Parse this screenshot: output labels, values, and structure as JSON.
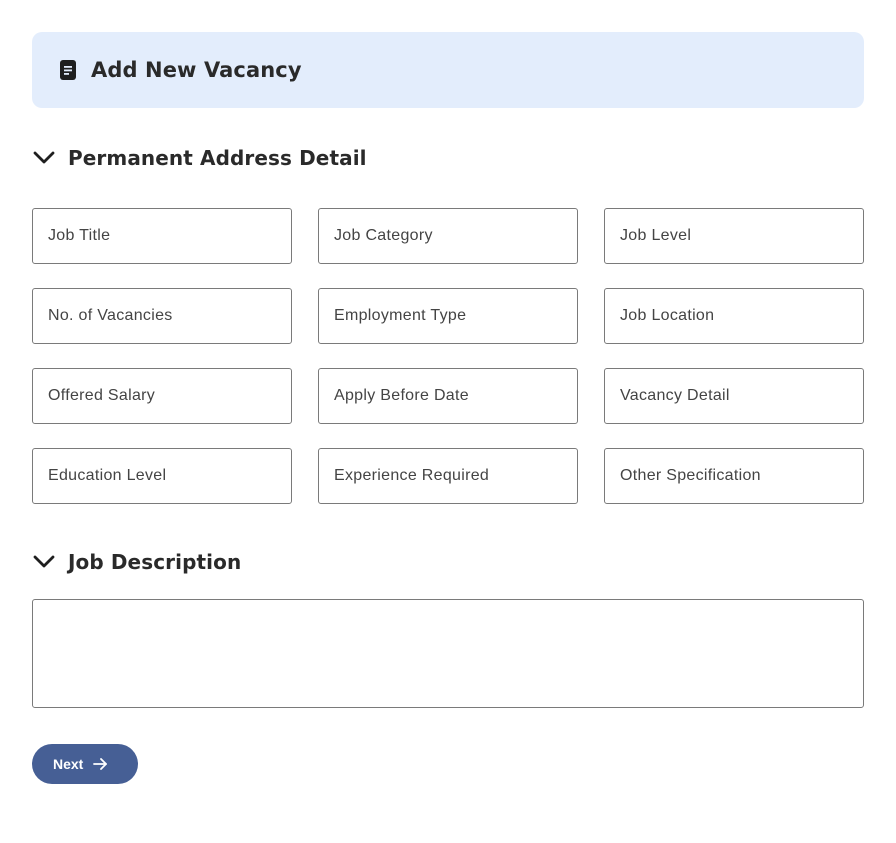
{
  "header": {
    "title": "Add New Vacancy",
    "icon": "document-icon",
    "background": "#e3edfc"
  },
  "sections": {
    "address": {
      "title": "Permanent Address Detail",
      "icon": "chevron-down-icon"
    },
    "description": {
      "title": "Job Description",
      "icon": "chevron-down-icon"
    }
  },
  "fields": [
    {
      "label": "Job Title"
    },
    {
      "label": "Job Category"
    },
    {
      "label": "Job Level"
    },
    {
      "label": "No. of Vacancies"
    },
    {
      "label": "Employment Type"
    },
    {
      "label": "Job Location"
    },
    {
      "label": "Offered Salary"
    },
    {
      "label": "Apply Before Date"
    },
    {
      "label": "Vacancy Detail"
    },
    {
      "label": "Education Level"
    },
    {
      "label": "Experience Required"
    },
    {
      "label": "Other Specification"
    }
  ],
  "job_description": {
    "value": ""
  },
  "actions": {
    "next_label": "Next",
    "next_icon": "arrow-right-icon",
    "accent": "#465f95"
  }
}
